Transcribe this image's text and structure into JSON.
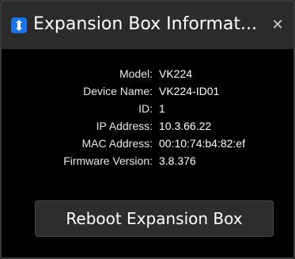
{
  "window": {
    "title": "Expansion Box Informat...",
    "close_icon": "close-icon",
    "app_icon": "app-logo-icon",
    "accent_color": "#1a73e8"
  },
  "info": {
    "rows": [
      {
        "label": "Model:",
        "value": "VK224"
      },
      {
        "label": "Device Name:",
        "value": "VK224-ID01"
      },
      {
        "label": "ID:",
        "value": "1"
      },
      {
        "label": "IP Address:",
        "value": "10.3.66.22"
      },
      {
        "label": "MAC Address:",
        "value": "00:10:74:b4:82:ef"
      },
      {
        "label": "Firmware Version:",
        "value": "3.8.376"
      }
    ]
  },
  "actions": {
    "reboot_label": "Reboot Expansion Box"
  }
}
